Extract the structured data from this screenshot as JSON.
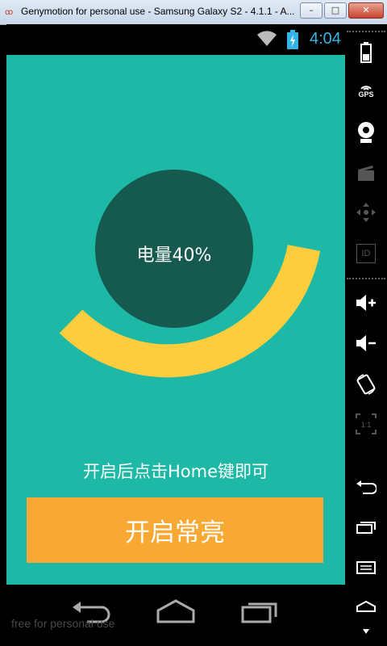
{
  "window": {
    "title": "Genymotion for personal use - Samsung Galaxy S2 - 4.1.1 - A...",
    "logo": "oo",
    "minimize": "–",
    "maximize": "□",
    "close": "✕"
  },
  "status_bar": {
    "time": "4:04",
    "wifi_icon": "wifi-icon",
    "battery_icon": "battery-charging-icon"
  },
  "app": {
    "battery_label": "电量40%",
    "battery_level_percent": 40,
    "hint": "开启后点击Home键即可",
    "button_label": "开启常亮"
  },
  "nav_bar": {
    "icons": [
      "back-icon",
      "home-icon",
      "recent-apps-icon"
    ]
  },
  "watermark": "free for personal use",
  "toolbar": {
    "items": [
      "battery-icon",
      "gps-icon",
      "webcam-icon",
      "clapper-icon",
      "dpad-icon",
      "id-icon",
      "volume-up-icon",
      "volume-down-icon",
      "rotate-icon",
      "scale-icon",
      "back-icon",
      "recent-apps-icon",
      "menu-icon",
      "home-icon",
      "more-icon"
    ],
    "gps_label": "GPS",
    "id_label": "ID",
    "ratio_label": "1:1"
  },
  "colors": {
    "app_background": "#1db9a6",
    "circle": "#15594f",
    "arc": "#fdcd3e",
    "button": "#f8a933",
    "status_time": "#33b5e5"
  }
}
